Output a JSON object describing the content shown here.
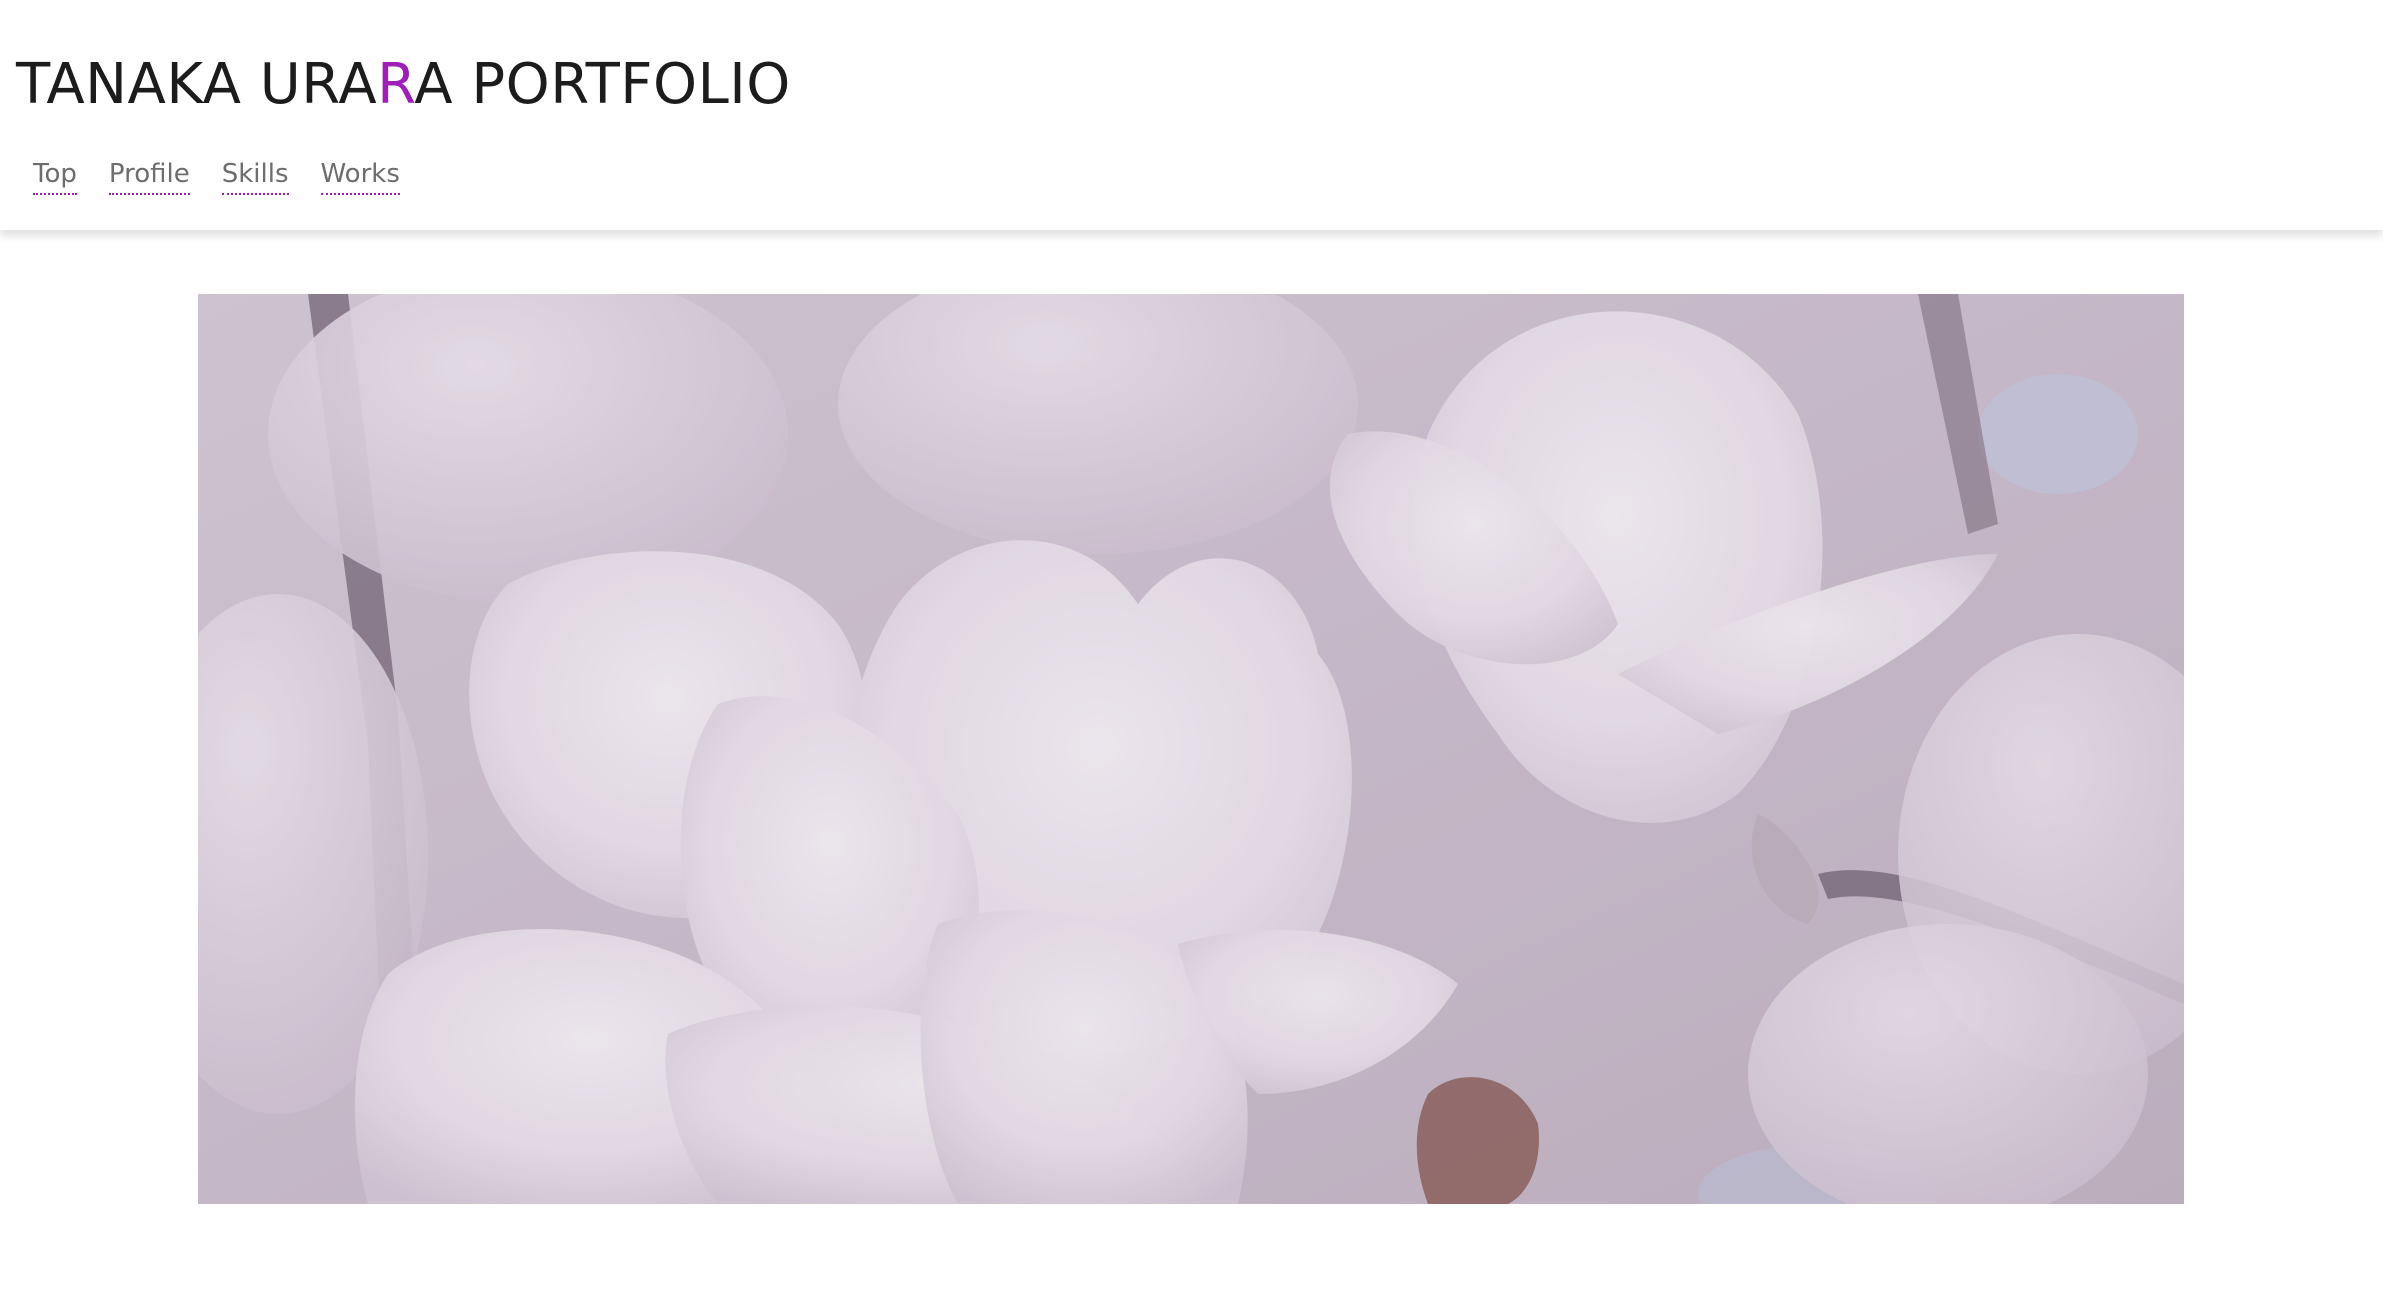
{
  "header": {
    "title_part1": "TANAKA URA",
    "title_accent": "R",
    "title_part2": "A PORTFOLIO",
    "accent_color": "#9d1fb5"
  },
  "nav": {
    "items": [
      {
        "label": "Top"
      },
      {
        "label": "Profile"
      },
      {
        "label": "Skills"
      },
      {
        "label": "Works"
      }
    ]
  },
  "hero": {
    "image": "magnolia-blossoms-photo",
    "tint_color": "#c9bccb"
  }
}
